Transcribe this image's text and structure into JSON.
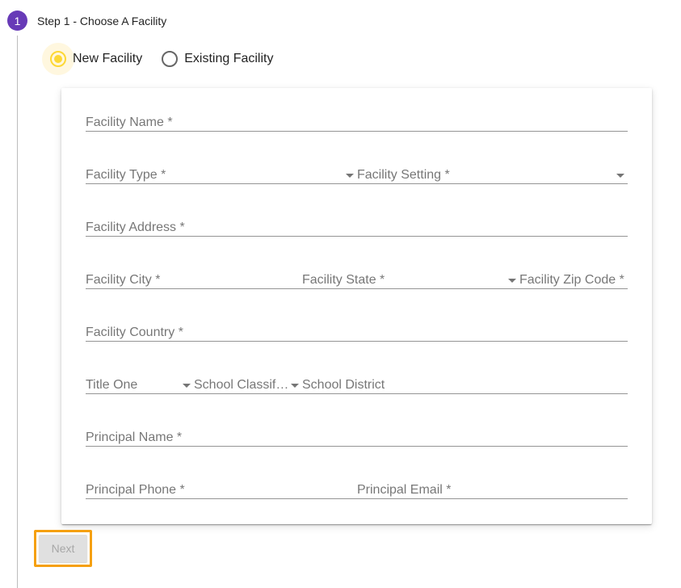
{
  "step": {
    "number": "1",
    "title": "Step 1 - Choose A Facility"
  },
  "facility_choice": {
    "selected": "New Facility",
    "options": [
      {
        "label": "New Facility",
        "checked": true
      },
      {
        "label": "Existing Facility",
        "checked": false
      }
    ]
  },
  "form": {
    "facility_name": "Facility Name *",
    "facility_type": "Facility Type *",
    "facility_setting": "Facility Setting *",
    "facility_address": "Facility Address *",
    "facility_city": "Facility City *",
    "facility_state": "Facility State *",
    "facility_zip": "Facility Zip Code *",
    "facility_country": "Facility Country *",
    "title_one": "Title One",
    "school_classification": "School Classification",
    "school_district": "School District",
    "principal_name": "Principal Name *",
    "principal_phone": "Principal Phone *",
    "principal_email": "Principal Email *"
  },
  "actions": {
    "next_label": "Next",
    "next_disabled": true
  },
  "colors": {
    "step_badge": "#673ab7",
    "radio_selected": "#fdd835",
    "focus_ring": "#f5a00f"
  }
}
